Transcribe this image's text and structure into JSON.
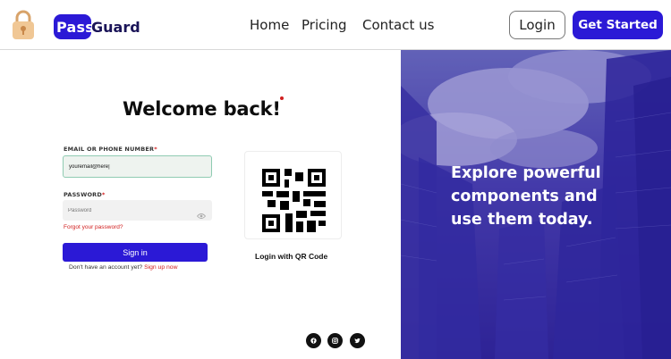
{
  "brand": {
    "name_part1": "Pass",
    "name_part2": "Guard",
    "accent_color": "#2b19d6"
  },
  "nav": {
    "items": [
      {
        "label": "Home"
      },
      {
        "label": "Pricing"
      },
      {
        "label": "Contact us"
      }
    ],
    "login_label": "Login",
    "get_started_label": "Get Started"
  },
  "login_form": {
    "heading": "Welcome back!",
    "email_label": "EMAIL OR PHONE NUMBER",
    "email_value": "youremail@here|",
    "password_label": "PASSWORD",
    "password_placeholder": "Password",
    "required_mark": "*",
    "forgot_label": "Forgot your password?",
    "signin_label": "Sign in",
    "signup_prompt": "Don't have an account yet?",
    "signup_link": "Sign up now",
    "qr_label": "Login with QR Code"
  },
  "social": [
    {
      "icon": "facebook-icon"
    },
    {
      "icon": "instagram-icon"
    },
    {
      "icon": "twitter-icon"
    }
  ],
  "hero": {
    "tagline": "Explore powerful components and use them today."
  }
}
